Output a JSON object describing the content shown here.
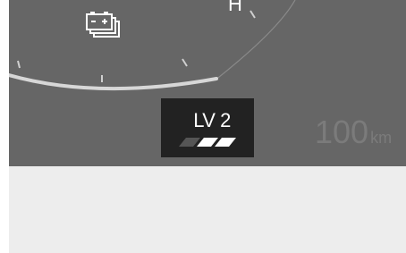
{
  "colors": {
    "cluster_background": "#666666",
    "lower_panel_background": "#ededed",
    "gauge_arc": "#d7d7d7",
    "level_box": "#222222",
    "text_primary": "#ffffff",
    "text_dim": "#7b7b7b"
  },
  "gauge": {
    "top_letter": "H",
    "indicator_icon": "battery-warning-icon"
  },
  "assist_level": {
    "label": "LV 2",
    "level": 2,
    "max_level": 3
  },
  "range": {
    "value": "100",
    "unit": "km"
  }
}
